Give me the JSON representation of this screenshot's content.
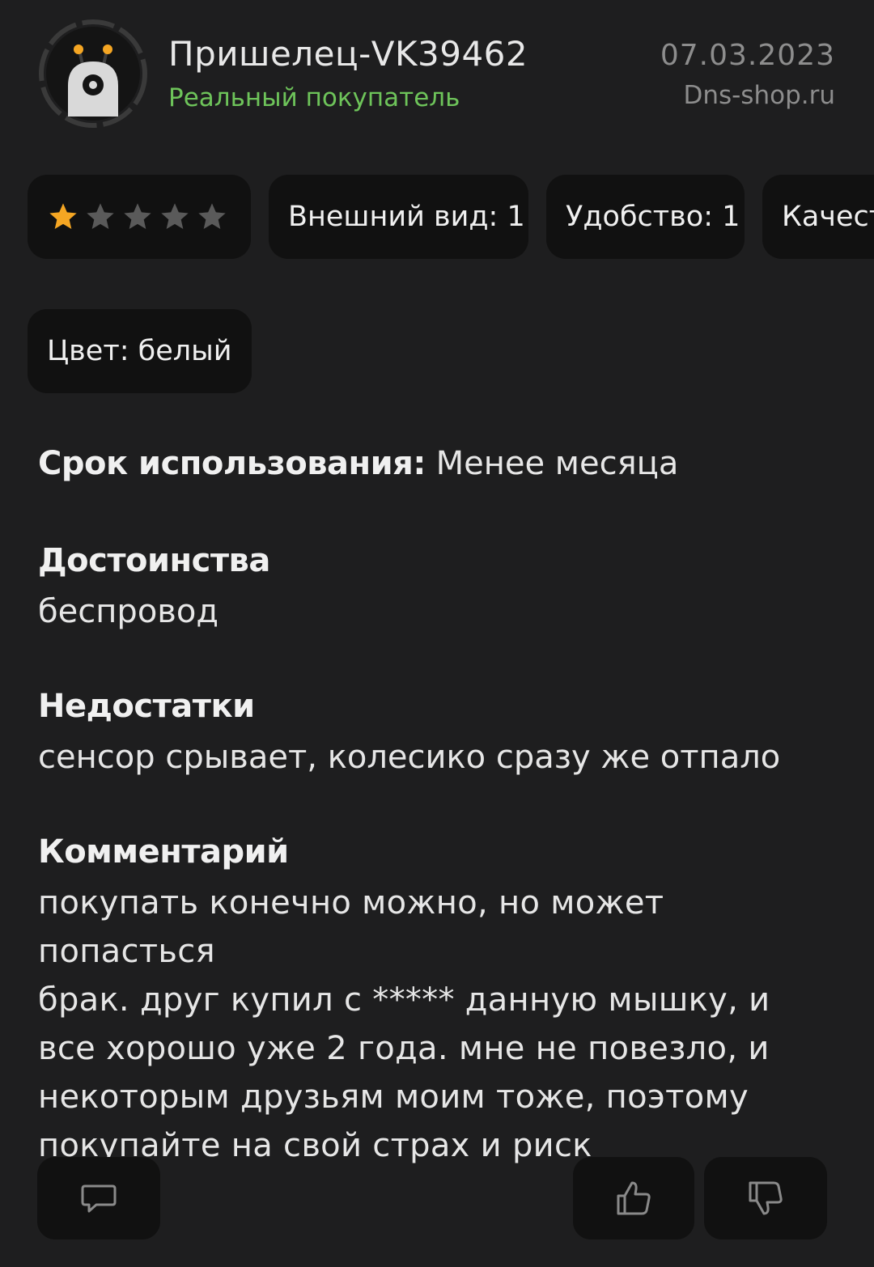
{
  "review": {
    "author": "Пришелец-VK39462",
    "badge": "Реальный покупатель",
    "date": "07.03.2023",
    "source": "Dns-shop.ru",
    "rating": 1,
    "rating_max": 5,
    "colors": {
      "star_active": "#f5a623",
      "star_inactive": "#5a5a5a",
      "badge": "#6ec45a"
    }
  },
  "chips": [
    {
      "label": "Внешний вид: 1"
    },
    {
      "label": "Удобство: 1"
    },
    {
      "label": "Качест"
    }
  ],
  "color_chip": {
    "label": "Цвет: белый"
  },
  "usage": {
    "label": "Срок использования:",
    "value": "Менее месяца"
  },
  "pros": {
    "title": "Достоинства",
    "text": "беспровод"
  },
  "cons": {
    "title": "Недостатки",
    "text": "сенсор срывает, колесико сразу же отпало"
  },
  "comment": {
    "title": "Комментарий",
    "text": "покупать конечно можно, но может попасться\nбрак. друг купил с ***** данную мышку, и\nвсе хорошо уже 2 года. мне не повезло, и\nнекоторым друзьям моим тоже, поэтому\nпокупайте на свой страх и риск"
  },
  "actions": {
    "icons": [
      "comment-icon",
      "thumbs-up-icon",
      "thumbs-down-icon"
    ]
  }
}
